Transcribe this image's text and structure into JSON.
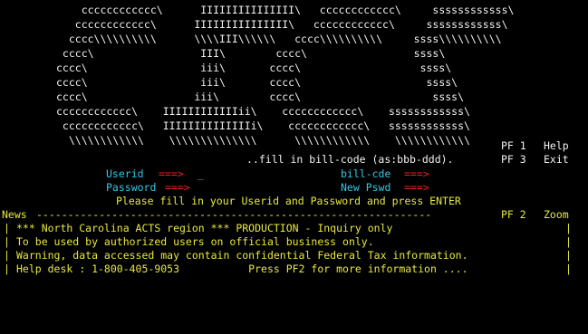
{
  "logo": {
    "lines": [
      "    cccccccccccc\\      IIIIIIIIIIIIIII\\   cccccccccccc\\     ssssssssssss\\",
      "   cccccccccccc\\      IIIIIIIIIIIIIII\\   cccccccccccc\\     ssssssssssss\\",
      "  cccc\\\\\\\\\\\\\\\\\\\\      \\\\\\\\III\\\\\\\\\\\\   cccc\\\\\\\\\\\\\\\\\\\\     ssss\\\\\\\\\\\\\\\\\\\\",
      " cccc\\                 III\\        cccc\\                 ssss\\",
      "cccc\\                  iii\\       cccc\\                   ssss\\",
      "cccc\\                  iii\\       cccc\\                    ssss\\",
      "cccc\\                 iii\\        cccc\\                     ssss\\",
      "cccccccccccc\\    IIIIIIIIIIIIii\\    cccccccccccc\\    ssssssssssss\\",
      " cccccccccccc\\   IIIIIIIIIIIIIIi\\    cccccccccccc\\   ssssssssssss\\",
      "  \\\\\\\\\\\\\\\\\\\\\\\\    \\\\\\\\\\\\\\\\\\\\\\\\\\\\      \\\\\\\\\\\\\\\\\\\\\\\\    \\\\\\\\\\\\\\\\\\\\\\\\"
    ]
  },
  "pf1": {
    "key": "PF 1",
    "label": "Help"
  },
  "pf3": {
    "key": "PF 3",
    "label": "Exit"
  },
  "pf2": {
    "key": "PF 2",
    "label": "Zoom"
  },
  "bill_code_hint": "..fill in bill-code (as:bbb-ddd).",
  "userid": {
    "label": "Userid",
    "arrow": "===>",
    "value": "_"
  },
  "password": {
    "label": "Password",
    "arrow": "===>",
    "value": ""
  },
  "bill_code": {
    "label": "bill-cde",
    "arrow": "===>",
    "value": ""
  },
  "new_pswd": {
    "label": "New Pswd",
    "arrow": "===>",
    "value": ""
  },
  "instruction": "Please fill in your Userid and Password and press ENTER",
  "news": {
    "label": "News",
    "rule": "---------------------------------------------------------------",
    "border": "|",
    "lines": [
      "*** North Carolina ACTS region *** PRODUCTION - Inquiry only",
      "To be used by authorized users on official business only.",
      "Warning, data accessed may contain confidential Federal Tax information.",
      "Help desk : 1-800-405-9053           Press PF2 for more information ...."
    ]
  },
  "colors": {
    "background": "#000000",
    "logo_text": "#f2f2f2",
    "field_label": "#33c9e6",
    "field_arrow": "#ee2222",
    "news_text": "#e8e840",
    "instruction": "#e8e840",
    "cursor": "#33d633"
  }
}
